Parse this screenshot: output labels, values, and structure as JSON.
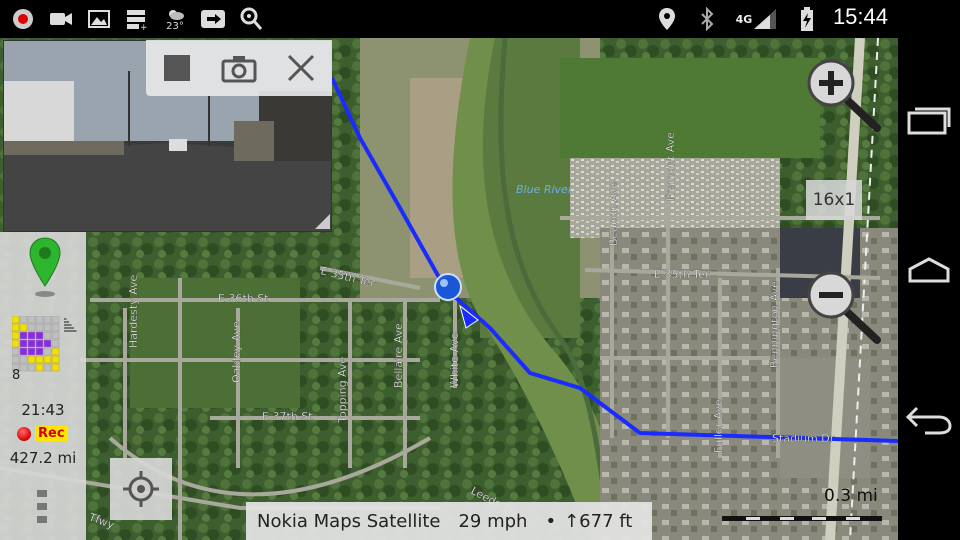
{
  "status_bar": {
    "icons": [
      "record-icon",
      "video-icon",
      "image-icon",
      "sd-card-icon",
      "weather-icon",
      "forward-icon",
      "map-search-icon"
    ],
    "temperature": "23°",
    "network": "4G",
    "time": "15:44"
  },
  "map": {
    "street_labels": [
      "E 35th Ter",
      "E 36th St",
      "E 37th St",
      "Oakley Ave",
      "Hardesty Ave",
      "Topping Ave",
      "Bellaire Ave",
      "White Ave",
      "Beacon Ave",
      "Fremont Ave",
      "Fuller Ave",
      "Bennington Ave",
      "E 35th Ter",
      "Stadium Dr",
      "Blue River",
      "Leeds Tfwy",
      "Tfwy"
    ]
  },
  "camera": {
    "controls": [
      "stop",
      "snapshot",
      "close"
    ]
  },
  "panel": {
    "satellite_count": "8",
    "elapsed_time": "21:43",
    "rec_label": "Rec",
    "distance": "427.2 mi"
  },
  "zoom": {
    "level": "16x1"
  },
  "info_bar": {
    "source": "Nokia Maps Satellite",
    "speed": "29 mph",
    "separator": "•",
    "altitude": "↑677 ft"
  },
  "scale": {
    "label": "0.3 mi"
  },
  "colors": {
    "route": "#1a2bff",
    "rec_bg": "#ffe600",
    "rec_text": "#d00000",
    "panel_bg": "#d7d7d7"
  }
}
